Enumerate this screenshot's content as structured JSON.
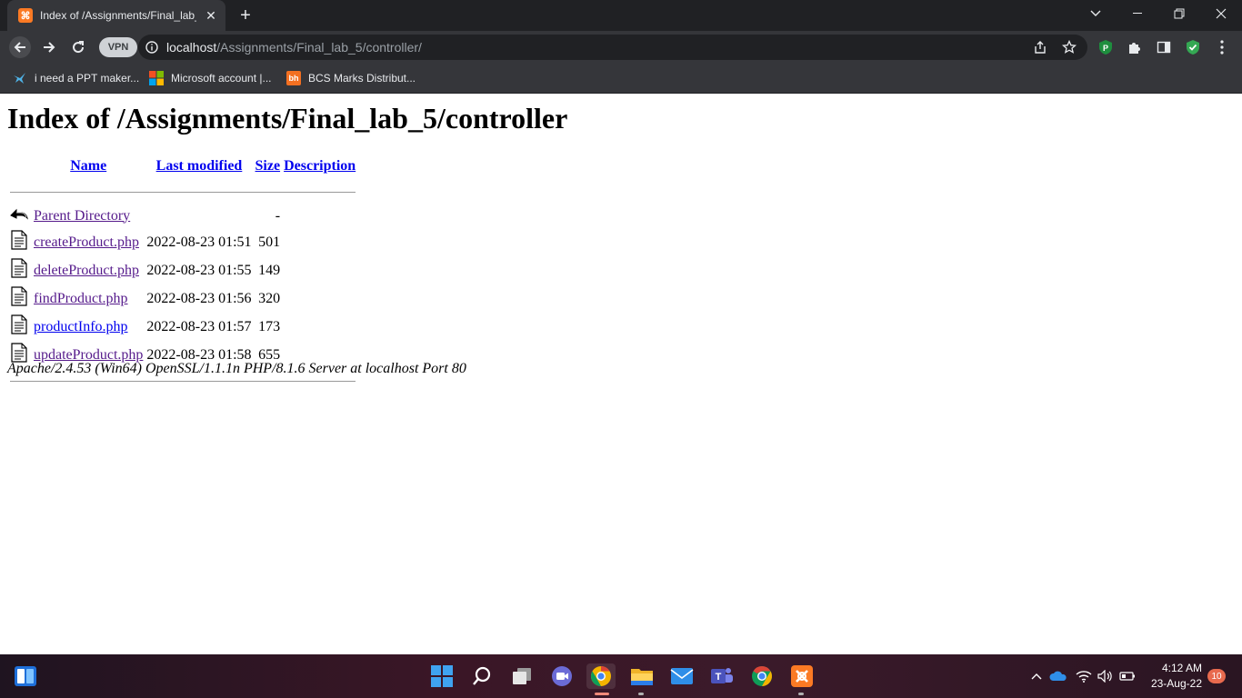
{
  "browser": {
    "tab_title": "Index of /Assignments/Final_lab_",
    "url_host": "localhost",
    "url_path": "/Assignments/Final_lab_5/controller/",
    "vpn_label": "VPN",
    "bookmarks": [
      {
        "label": "i need a PPT maker...",
        "icon": "bird-icon"
      },
      {
        "label": "Microsoft account |...",
        "icon": "microsoft-icon"
      },
      {
        "label": "BCS Marks Distribut...",
        "icon": "bh-icon",
        "icon_text": "bh"
      }
    ]
  },
  "page": {
    "title": "Index of /Assignments/Final_lab_5/controller",
    "columns": {
      "name": "Name",
      "last_modified": "Last modified",
      "size": "Size",
      "description": "Description"
    },
    "parent": {
      "name": "Parent Directory",
      "size": "-"
    },
    "files": [
      {
        "name": "createProduct.php",
        "modified": "2022-08-23 01:51",
        "size": "501"
      },
      {
        "name": "deleteProduct.php",
        "modified": "2022-08-23 01:55",
        "size": "149"
      },
      {
        "name": "findProduct.php",
        "modified": "2022-08-23 01:56",
        "size": "320"
      },
      {
        "name": "productInfo.php",
        "modified": "2022-08-23 01:57",
        "size": "173"
      },
      {
        "name": "updateProduct.php",
        "modified": "2022-08-23 01:58",
        "size": "655"
      }
    ],
    "footer": "Apache/2.4.53 (Win64) OpenSSL/1.1.1n PHP/8.1.6 Server at localhost Port 80"
  },
  "taskbar": {
    "time": "4:12 AM",
    "date": "23-Aug-22",
    "notification_count": "10"
  },
  "colors": {
    "link": "#0000ee",
    "visited_link": "#551a8b",
    "xampp_orange": "#fb7a24",
    "chrome_dark": "#202124",
    "chrome_toolbar": "#35363a"
  }
}
